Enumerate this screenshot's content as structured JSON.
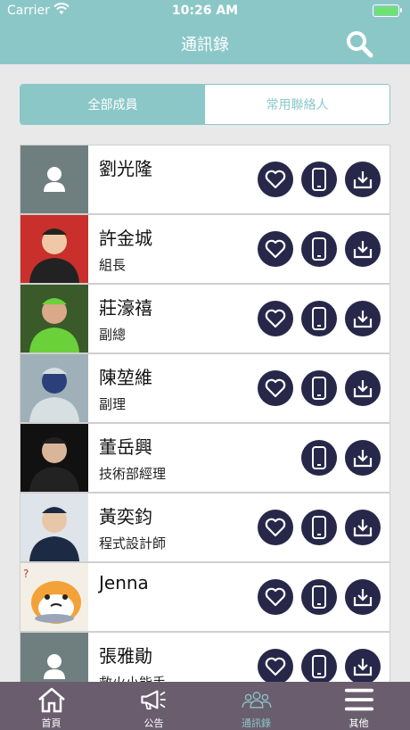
{
  "status_bar": {
    "carrier": "Carrier",
    "time": "10:26 AM"
  },
  "nav": {
    "title": "通訊錄",
    "search_icon": "search-icon"
  },
  "segments": [
    {
      "label": "全部成員",
      "active": true
    },
    {
      "label": "常用聯絡人",
      "active": false
    }
  ],
  "contacts": [
    {
      "name": "劉光隆",
      "title": "",
      "avatar": "placeholder",
      "show_favorite": true
    },
    {
      "name": "許金城",
      "title": "組長",
      "avatar": "photo",
      "show_favorite": true
    },
    {
      "name": "莊濠禧",
      "title": "副總",
      "avatar": "photo",
      "show_favorite": true
    },
    {
      "name": "陳堃維",
      "title": "副理",
      "avatar": "photo",
      "show_favorite": true
    },
    {
      "name": "董岳興",
      "title": "技術部經理",
      "avatar": "photo",
      "show_favorite": false
    },
    {
      "name": "黃奕鈞",
      "title": "程式設計師",
      "avatar": "photo",
      "show_favorite": true
    },
    {
      "name": "Jenna",
      "title": "",
      "avatar": "cartoon",
      "show_favorite": true
    },
    {
      "name": "張雅勛",
      "title": "救火小能手",
      "avatar": "placeholder",
      "show_favorite": true
    }
  ],
  "tabbar": [
    {
      "label": "首頁",
      "icon": "home-icon",
      "active": false
    },
    {
      "label": "公告",
      "icon": "megaphone-icon",
      "active": false
    },
    {
      "label": "通訊錄",
      "icon": "contacts-icon",
      "active": true
    },
    {
      "label": "其他",
      "icon": "menu-icon",
      "active": false
    }
  ],
  "colors": {
    "accent": "#8cc7c8",
    "action": "#27274a",
    "tabbar": "#6a5e6e"
  }
}
